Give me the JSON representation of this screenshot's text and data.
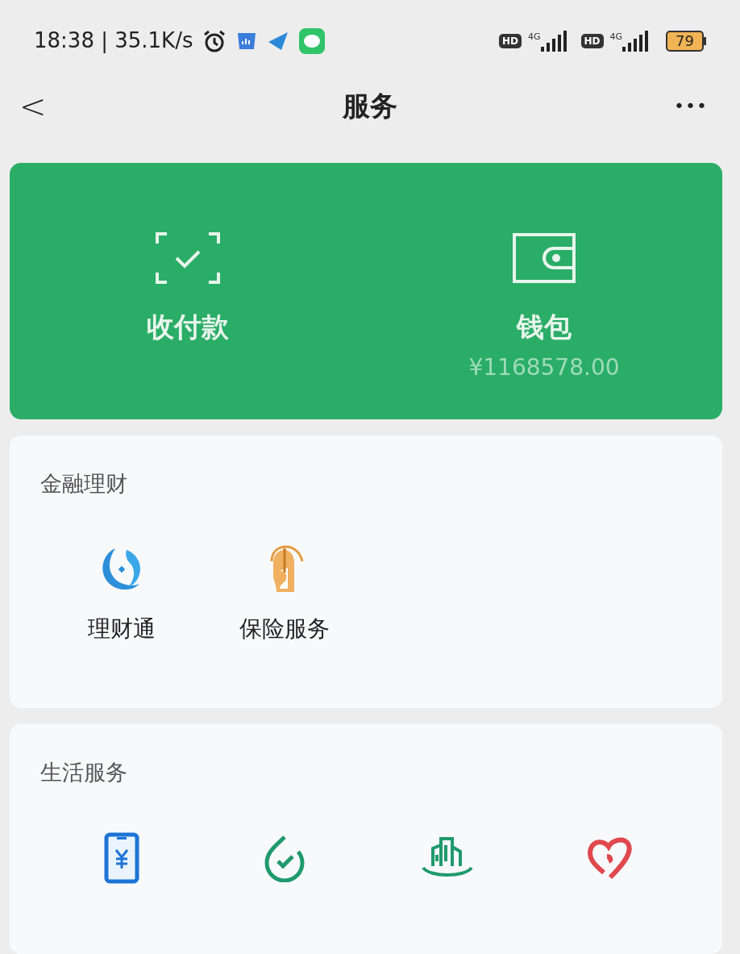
{
  "status_bar": {
    "time_speed": "18:38 | 35.1K/s",
    "sim1_hd": "HD",
    "sim1_net": "4G",
    "sim2_hd": "HD",
    "sim2_net": "4G",
    "battery": "79"
  },
  "header": {
    "title": "服务",
    "back": "<",
    "more": "•••"
  },
  "hero": {
    "items": [
      {
        "kind": "scan",
        "label": "收付款"
      },
      {
        "kind": "wallet",
        "label": "钱包",
        "amount": "¥1168578.00"
      }
    ]
  },
  "sections": [
    {
      "title": "金融理财",
      "items": [
        {
          "kind": "wealth",
          "label": "理财通"
        },
        {
          "kind": "insurance",
          "label": "保险服务"
        }
      ]
    },
    {
      "title": "生活服务",
      "items": [
        {
          "kind": "phone"
        },
        {
          "kind": "bill"
        },
        {
          "kind": "city"
        },
        {
          "kind": "charity"
        }
      ]
    }
  ]
}
